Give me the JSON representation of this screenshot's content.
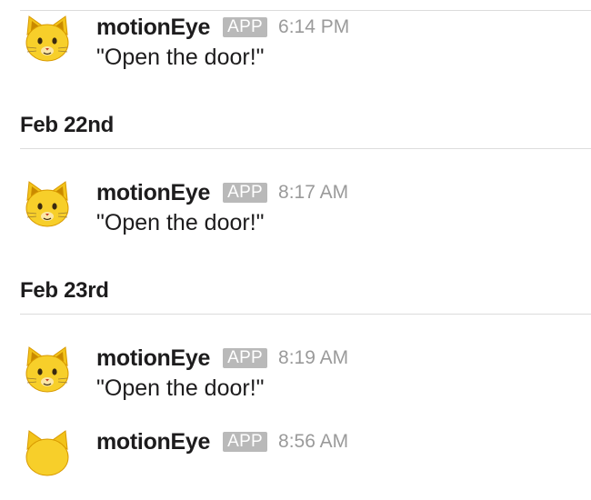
{
  "messages_top": [
    {
      "sender": "motionEye",
      "badge": "APP",
      "time": "6:14 PM",
      "text": "\"Open the door!\"",
      "avatar_icon": "cat-face-icon"
    }
  ],
  "days": [
    {
      "label": "Feb 22nd",
      "messages": [
        {
          "sender": "motionEye",
          "badge": "APP",
          "time": "8:17 AM",
          "text": "\"Open the door!\"",
          "avatar_icon": "cat-face-icon"
        }
      ]
    },
    {
      "label": "Feb 23rd",
      "messages": [
        {
          "sender": "motionEye",
          "badge": "APP",
          "time": "8:19 AM",
          "text": "\"Open the door!\"",
          "avatar_icon": "cat-face-icon"
        },
        {
          "sender": "motionEye",
          "badge": "APP",
          "time": "8:56 AM",
          "text": "",
          "avatar_icon": "cat-face-icon"
        }
      ]
    }
  ],
  "colors": {
    "badge_bg": "#b9b9b9",
    "timestamp": "#9a9a9a",
    "text": "#1d1c1d",
    "divider": "#dcdcdc"
  }
}
